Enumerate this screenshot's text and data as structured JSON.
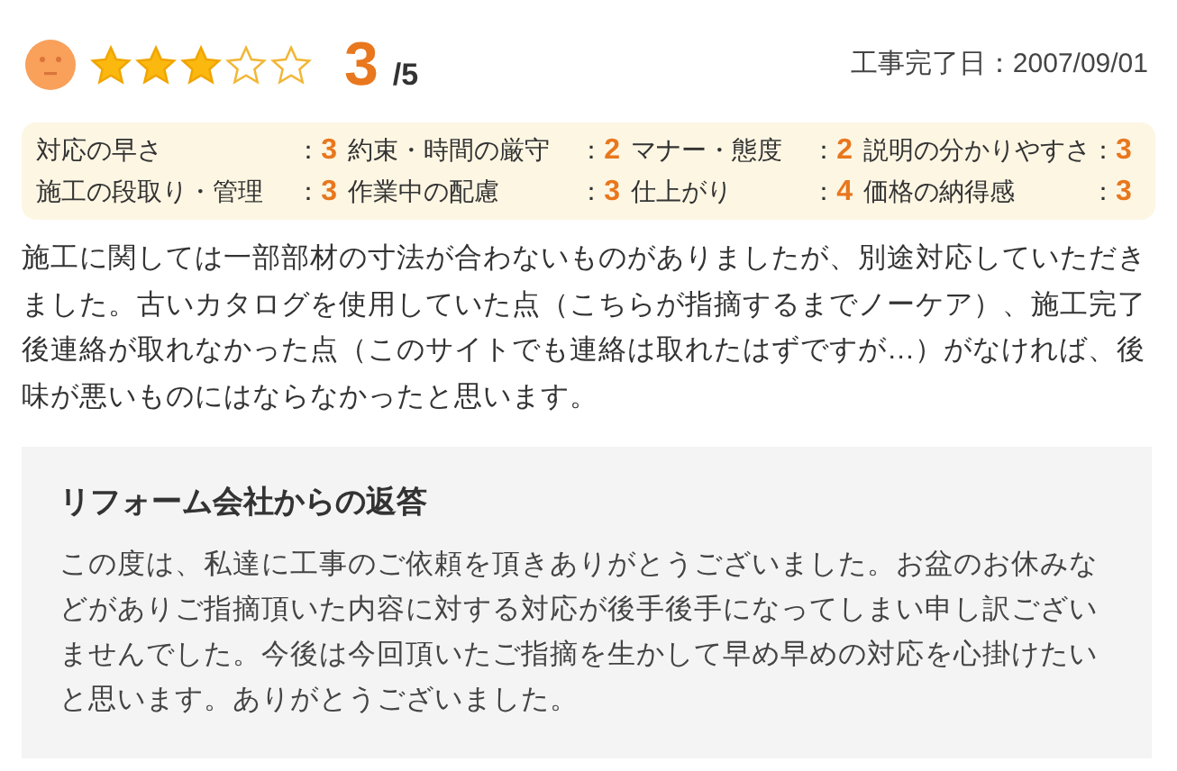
{
  "rating": {
    "stars": 3,
    "score": "3",
    "max": "/5"
  },
  "completion_date": "工事完了日：2007/09/01",
  "criteria": [
    {
      "label": "対応の早さ",
      "separator": "：",
      "score": "3"
    },
    {
      "label": "約束・時間の厳守",
      "separator": "：",
      "score": "2"
    },
    {
      "label": "マナー・態度",
      "separator": "：",
      "score": "2"
    },
    {
      "label": "説明の分かりやすさ",
      "separator": "：",
      "score": "3"
    },
    {
      "label": "施工の段取り・管理",
      "separator": "：",
      "score": "3"
    },
    {
      "label": "作業中の配慮",
      "separator": "：",
      "score": "3"
    },
    {
      "label": "仕上がり",
      "separator": "：",
      "score": "4"
    },
    {
      "label": "価格の納得感",
      "separator": "：",
      "score": "3"
    }
  ],
  "review": "施工に関しては一部部材の寸法が合わないものがありましたが、別途対応していただきました。古いカタログを使用していた点（こちらが指摘するまでノーケア）、施工完了後連絡が取れなかった点（このサイトでも連絡は取れたはずですが…）がなければ、後味が悪いものにはならなかったと思います。",
  "reply": {
    "title": "リフォーム会社からの返答",
    "body": "この度は、私達に工事のご依頼を頂きありがとうございました。お盆のお休みなどがありご指摘頂いた内容に対する対応が後手後手になってしまい申し訳ございませんでした。今後は今回頂いたご指摘を生かして早め早めの対応を心掛けたいと思います。ありがとうございました。"
  }
}
